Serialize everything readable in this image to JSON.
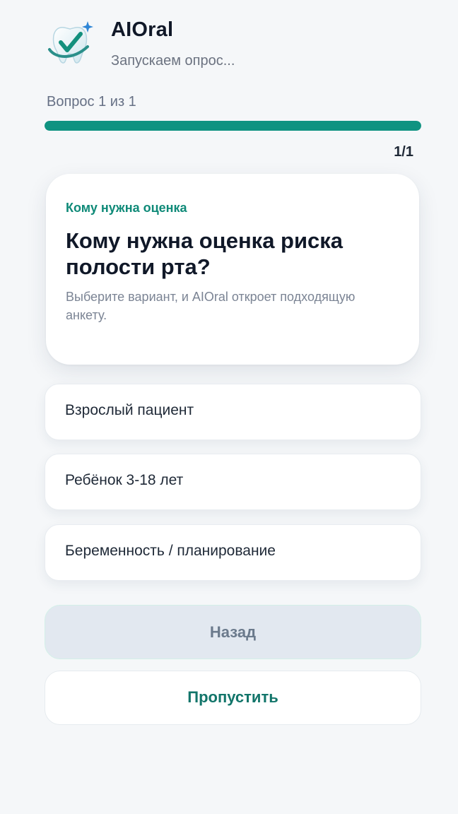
{
  "header": {
    "logo_icon": "tooth-check-icon",
    "title": "AIOral",
    "subtitle": "Запускаем опрос..."
  },
  "progress": {
    "label": "Вопрос 1 из 1",
    "count": "1/1",
    "fraction": 1.0,
    "color": "#0f9381"
  },
  "question": {
    "category": "Кому нужна оценка",
    "title": "Кому нужна оценка риска полости рта?",
    "hint": "Выберите вариант, и AIOral откроет подходящую анкету."
  },
  "options": [
    {
      "label": "Взрослый пациент"
    },
    {
      "label": "Ребёнок 3-18 лет"
    },
    {
      "label": "Беременность / планирование"
    }
  ],
  "buttons": {
    "back_label": "Назад",
    "skip_label": "Пропустить"
  },
  "colors": {
    "accent": "#0f9381",
    "category_text": "#0f8a78",
    "skip_text": "#12756a",
    "back_bg": "#e2e8f0"
  }
}
